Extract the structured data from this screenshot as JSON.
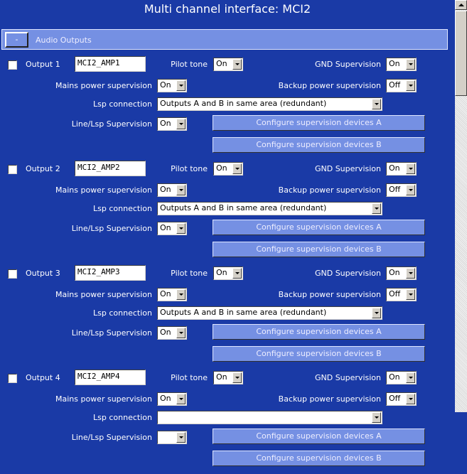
{
  "title": "Multi channel interface: MCI2",
  "section": {
    "toggle_label": "-",
    "label": "Audio Outputs"
  },
  "labels": {
    "pilot_tone": "Pilot tone",
    "gnd_supervision": "GND Supervision",
    "mains_power": "Mains power supervision",
    "backup_power": "Backup power supervision",
    "lsp_connection": "Lsp connection",
    "line_lsp": "Line/Lsp Supervision",
    "configure_a": "Configure supervision devices A",
    "configure_b": "Configure supervision devices B"
  },
  "outputs": [
    {
      "label": "Output 1",
      "name": "MCI2_AMP1",
      "checked": false,
      "pilot_tone": "On",
      "gnd_supervision": "On",
      "mains_power": "On",
      "backup_power": "Off",
      "lsp_connection": "Outputs A and B in same area (redundant)",
      "line_lsp": "On"
    },
    {
      "label": "Output 2",
      "name": "MCI2_AMP2",
      "checked": false,
      "pilot_tone": "On",
      "gnd_supervision": "On",
      "mains_power": "On",
      "backup_power": "Off",
      "lsp_connection": "Outputs A and B in same area (redundant)",
      "line_lsp": "On"
    },
    {
      "label": "Output 3",
      "name": "MCI2_AMP3",
      "checked": false,
      "pilot_tone": "On",
      "gnd_supervision": "On",
      "mains_power": "On",
      "backup_power": "Off",
      "lsp_connection": "Outputs A and B in same area (redundant)",
      "line_lsp": "On"
    },
    {
      "label": "Output 4",
      "name": "MCI2_AMP4",
      "checked": false,
      "pilot_tone": "On",
      "gnd_supervision": "On",
      "mains_power": "On",
      "backup_power": "Off",
      "lsp_connection": "",
      "line_lsp": ""
    }
  ]
}
